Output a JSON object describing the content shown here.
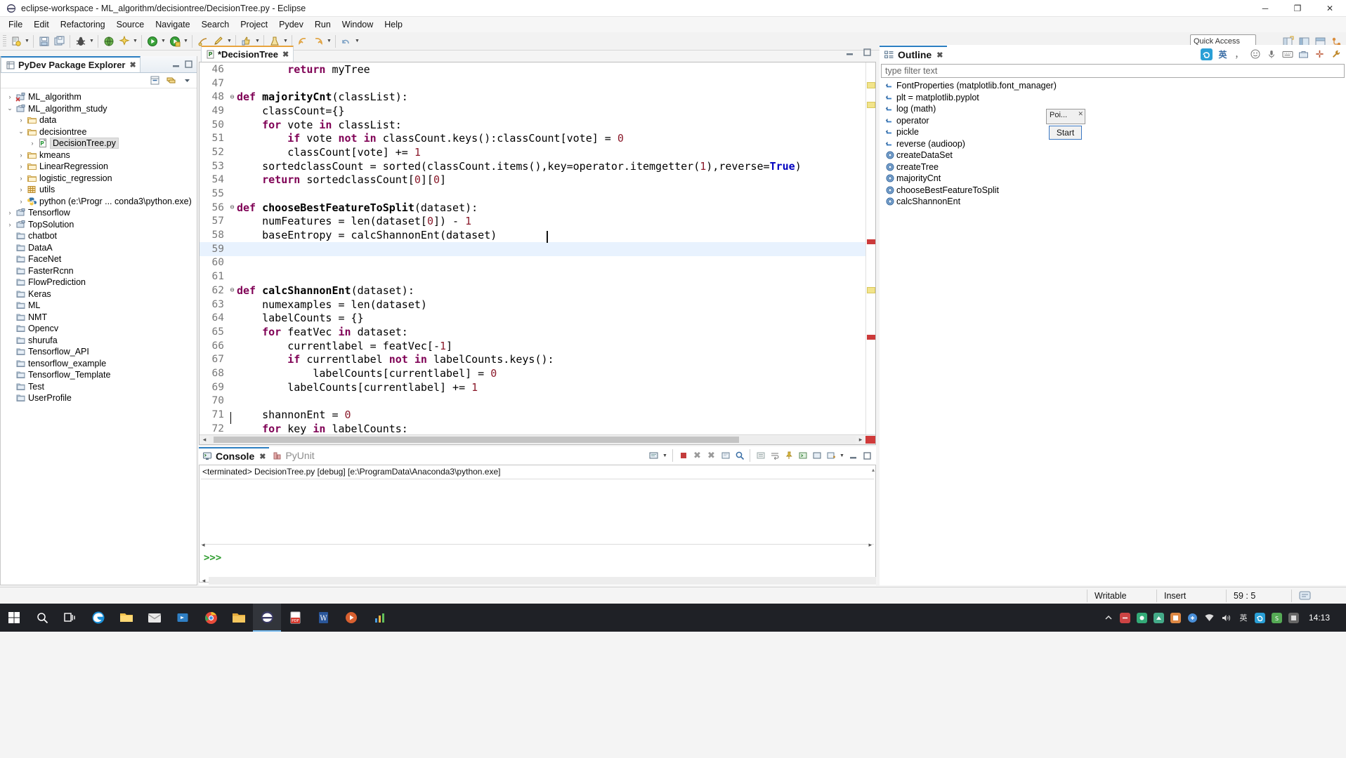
{
  "window": {
    "title": "eclipse-workspace - ML_algorithm/decisiontree/DecisionTree.py - Eclipse",
    "icon": "eclipse-icon",
    "minimize_label": "─",
    "maximize_label": "❐",
    "close_label": "✕"
  },
  "menubar": {
    "items": [
      {
        "label": "File"
      },
      {
        "label": "Edit"
      },
      {
        "label": "Refactoring"
      },
      {
        "label": "Source"
      },
      {
        "label": "Navigate"
      },
      {
        "label": "Search"
      },
      {
        "label": "Project"
      },
      {
        "label": "Pydev"
      },
      {
        "label": "Run"
      },
      {
        "label": "Window"
      },
      {
        "label": "Help"
      }
    ]
  },
  "toolbar": {
    "quick_access_placeholder": "Quick Access"
  },
  "explorer": {
    "title": "PyDev Package Explorer",
    "close_label": "✖",
    "tree": [
      {
        "label": "ML_algorithm",
        "depth": 0,
        "twist": "›",
        "icon": "project-error-icon"
      },
      {
        "label": "ML_algorithm_study",
        "depth": 0,
        "twist": "⌄",
        "icon": "project-icon"
      },
      {
        "label": "data",
        "depth": 1,
        "twist": "›",
        "icon": "folder-icon"
      },
      {
        "label": "decisiontree",
        "depth": 1,
        "twist": "⌄",
        "icon": "folder-icon"
      },
      {
        "label": "DecisionTree.py",
        "depth": 2,
        "twist": "›",
        "icon": "python-file-icon",
        "selected": true
      },
      {
        "label": "kmeans",
        "depth": 1,
        "twist": "›",
        "icon": "folder-icon"
      },
      {
        "label": "LinearRegression",
        "depth": 1,
        "twist": "›",
        "icon": "folder-icon"
      },
      {
        "label": "logistic_regression",
        "depth": 1,
        "twist": "›",
        "icon": "folder-icon"
      },
      {
        "label": "utils",
        "depth": 1,
        "twist": "›",
        "icon": "package-icon"
      },
      {
        "label": "python  (e:\\Progr ... conda3\\python.exe)",
        "depth": 1,
        "twist": "›",
        "icon": "python-interp-icon"
      },
      {
        "label": "Tensorflow",
        "depth": 0,
        "twist": "›",
        "icon": "project-icon"
      },
      {
        "label": "TopSolution",
        "depth": 0,
        "twist": "›",
        "icon": "project-icon"
      },
      {
        "label": "chatbot",
        "depth": 0,
        "twist": "",
        "icon": "closed-project-icon"
      },
      {
        "label": "DataA",
        "depth": 0,
        "twist": "",
        "icon": "closed-project-icon"
      },
      {
        "label": "FaceNet",
        "depth": 0,
        "twist": "",
        "icon": "closed-project-icon"
      },
      {
        "label": "FasterRcnn",
        "depth": 0,
        "twist": "",
        "icon": "closed-project-icon"
      },
      {
        "label": "FlowPrediction",
        "depth": 0,
        "twist": "",
        "icon": "closed-project-icon"
      },
      {
        "label": "Keras",
        "depth": 0,
        "twist": "",
        "icon": "closed-project-icon"
      },
      {
        "label": "ML",
        "depth": 0,
        "twist": "",
        "icon": "closed-project-icon"
      },
      {
        "label": "NMT",
        "depth": 0,
        "twist": "",
        "icon": "closed-project-icon"
      },
      {
        "label": "Opencv",
        "depth": 0,
        "twist": "",
        "icon": "closed-project-icon"
      },
      {
        "label": "shurufa",
        "depth": 0,
        "twist": "",
        "icon": "closed-project-icon"
      },
      {
        "label": "Tensorflow_API",
        "depth": 0,
        "twist": "",
        "icon": "closed-project-icon"
      },
      {
        "label": "tensorflow_example",
        "depth": 0,
        "twist": "",
        "icon": "closed-project-icon"
      },
      {
        "label": "Tensorflow_Template",
        "depth": 0,
        "twist": "",
        "icon": "closed-project-icon"
      },
      {
        "label": "Test",
        "depth": 0,
        "twist": "",
        "icon": "closed-project-icon"
      },
      {
        "label": "UserProfile",
        "depth": 0,
        "twist": "",
        "icon": "closed-project-icon"
      }
    ]
  },
  "editor": {
    "tab_label": "*DecisionTree",
    "tab_close": "✖",
    "first_line": 46,
    "cursor_line": 59,
    "lines": [
      {
        "n": 46,
        "indent": 2,
        "tokens": [
          {
            "t": "return",
            "c": "kw"
          },
          {
            "t": " myTree",
            "c": ""
          }
        ]
      },
      {
        "n": 47,
        "indent": 0,
        "tokens": []
      },
      {
        "n": 48,
        "indent": 0,
        "fold": "⊖",
        "tokens": [
          {
            "t": "def",
            "c": "kw"
          },
          {
            "t": " ",
            "c": ""
          },
          {
            "t": "majorityCnt",
            "c": "fn"
          },
          {
            "t": "(classList):",
            "c": ""
          }
        ]
      },
      {
        "n": 49,
        "indent": 1,
        "tokens": [
          {
            "t": "classCount={}",
            "c": ""
          }
        ]
      },
      {
        "n": 50,
        "indent": 1,
        "tokens": [
          {
            "t": "for",
            "c": "kw"
          },
          {
            "t": " vote ",
            "c": ""
          },
          {
            "t": "in",
            "c": "kw"
          },
          {
            "t": " classList:",
            "c": ""
          }
        ]
      },
      {
        "n": 51,
        "indent": 2,
        "tokens": [
          {
            "t": "if",
            "c": "kw"
          },
          {
            "t": " vote ",
            "c": ""
          },
          {
            "t": "not",
            "c": "kw"
          },
          {
            "t": " ",
            "c": ""
          },
          {
            "t": "in",
            "c": "kw"
          },
          {
            "t": " classCount.keys():classCount[vote] = ",
            "c": ""
          },
          {
            "t": "0",
            "c": "num"
          }
        ]
      },
      {
        "n": 52,
        "indent": 2,
        "tokens": [
          {
            "t": "classCount[vote] += ",
            "c": ""
          },
          {
            "t": "1",
            "c": "num"
          }
        ]
      },
      {
        "n": 53,
        "indent": 1,
        "tokens": [
          {
            "t": "sortedclassCount = sorted(classCount.items(),key=operator.itemgetter(",
            "c": ""
          },
          {
            "t": "1",
            "c": "num"
          },
          {
            "t": "),reverse=",
            "c": ""
          },
          {
            "t": "True",
            "c": "kw2"
          },
          {
            "t": ")",
            "c": ""
          }
        ]
      },
      {
        "n": 54,
        "indent": 1,
        "tokens": [
          {
            "t": "return",
            "c": "kw"
          },
          {
            "t": " sortedclassCount[",
            "c": ""
          },
          {
            "t": "0",
            "c": "num"
          },
          {
            "t": "][",
            "c": ""
          },
          {
            "t": "0",
            "c": "num"
          },
          {
            "t": "]",
            "c": ""
          }
        ]
      },
      {
        "n": 55,
        "indent": 0,
        "tokens": []
      },
      {
        "n": 56,
        "indent": 0,
        "fold": "⊖",
        "tokens": [
          {
            "t": "def",
            "c": "kw"
          },
          {
            "t": " ",
            "c": ""
          },
          {
            "t": "chooseBestFeatureToSplit",
            "c": "fn"
          },
          {
            "t": "(dataset):",
            "c": ""
          }
        ]
      },
      {
        "n": 57,
        "indent": 1,
        "marker": "error",
        "tokens": [
          {
            "t": "numFeatures = len(dataset[",
            "c": ""
          },
          {
            "t": "0",
            "c": "num"
          },
          {
            "t": "]) - ",
            "c": ""
          },
          {
            "t": "1",
            "c": "num"
          }
        ]
      },
      {
        "n": 58,
        "indent": 1,
        "marker": "error",
        "tokens": [
          {
            "t": "baseEntropy = calcShannonEnt(dataset)",
            "c": ""
          }
        ]
      },
      {
        "n": 59,
        "indent": 0,
        "current": true,
        "tokens": []
      },
      {
        "n": 60,
        "indent": 0,
        "tokens": []
      },
      {
        "n": 61,
        "indent": 0,
        "tokens": []
      },
      {
        "n": 62,
        "indent": 0,
        "fold": "⊖",
        "tokens": [
          {
            "t": "def",
            "c": "kw"
          },
          {
            "t": " ",
            "c": ""
          },
          {
            "t": "calcShannonEnt",
            "c": "fn"
          },
          {
            "t": "(dataset):",
            "c": ""
          }
        ]
      },
      {
        "n": 63,
        "indent": 1,
        "tokens": [
          {
            "t": "numexamples = len(dataset)",
            "c": ""
          }
        ]
      },
      {
        "n": 64,
        "indent": 1,
        "tokens": [
          {
            "t": "labelCounts = {}",
            "c": ""
          }
        ]
      },
      {
        "n": 65,
        "indent": 1,
        "tokens": [
          {
            "t": "for",
            "c": "kw"
          },
          {
            "t": " featVec ",
            "c": ""
          },
          {
            "t": "in",
            "c": "kw"
          },
          {
            "t": " dataset:",
            "c": ""
          }
        ]
      },
      {
        "n": 66,
        "indent": 2,
        "tokens": [
          {
            "t": "currentlabel = featVec[-",
            "c": ""
          },
          {
            "t": "1",
            "c": "num"
          },
          {
            "t": "]",
            "c": ""
          }
        ]
      },
      {
        "n": 67,
        "indent": 2,
        "tokens": [
          {
            "t": "if",
            "c": "kw"
          },
          {
            "t": " currentlabel ",
            "c": ""
          },
          {
            "t": "not",
            "c": "kw"
          },
          {
            "t": " ",
            "c": ""
          },
          {
            "t": "in",
            "c": "kw"
          },
          {
            "t": " labelCounts.keys():",
            "c": ""
          }
        ]
      },
      {
        "n": 68,
        "indent": 3,
        "tokens": [
          {
            "t": "labelCounts[currentlabel] = ",
            "c": ""
          },
          {
            "t": "0",
            "c": "num"
          }
        ]
      },
      {
        "n": 69,
        "indent": 2,
        "tokens": [
          {
            "t": "labelCounts[currentlabel] += ",
            "c": ""
          },
          {
            "t": "1",
            "c": "num"
          }
        ]
      },
      {
        "n": 70,
        "indent": 0,
        "tokens": []
      },
      {
        "n": 71,
        "indent": 1,
        "tokens": [
          {
            "t": "shannonEnt = ",
            "c": ""
          },
          {
            "t": "0",
            "c": "num"
          }
        ]
      },
      {
        "n": 72,
        "indent": 1,
        "tokens": [
          {
            "t": "for",
            "c": "kw"
          },
          {
            "t": " key ",
            "c": ""
          },
          {
            "t": "in",
            "c": "kw"
          },
          {
            "t": " labelCounts:",
            "c": ""
          }
        ]
      }
    ]
  },
  "outline": {
    "title": "Outline",
    "close_label": "✖",
    "filter_placeholder": "type filter text",
    "items": [
      {
        "label": "FontProperties (matplotlib.font_manager)",
        "icon": "import-icon"
      },
      {
        "label": "plt = matplotlib.pyplot",
        "icon": "import-icon"
      },
      {
        "label": "log (math)",
        "icon": "import-icon"
      },
      {
        "label": "operator",
        "icon": "import-icon"
      },
      {
        "label": "pickle",
        "icon": "import-icon"
      },
      {
        "label": "reverse (audioop)",
        "icon": "import-icon"
      },
      {
        "label": "createDataSet",
        "icon": "method-icon"
      },
      {
        "label": "createTree",
        "icon": "method-icon"
      },
      {
        "label": "majorityCnt",
        "icon": "method-icon"
      },
      {
        "label": "chooseBestFeatureToSplit",
        "icon": "method-icon"
      },
      {
        "label": "calcShannonEnt",
        "icon": "method-icon"
      }
    ]
  },
  "popup": {
    "title": "Poi...",
    "close_label": "✕",
    "start_label": "Start"
  },
  "console": {
    "tab_label": "Console",
    "tab_close": "✖",
    "tab2_label": "PyUnit",
    "terminated_text": "<terminated> DecisionTree.py [debug] [e:\\ProgramData\\Anaconda3\\python.exe]",
    "prompt": ">>>"
  },
  "statusbar": {
    "writable": "Writable",
    "insert": "Insert",
    "position": "59 : 5"
  },
  "taskbar": {
    "clock_time": "14:13",
    "items": [
      {
        "icon": "windows-start-icon"
      },
      {
        "icon": "search-icon"
      },
      {
        "icon": "task-view-icon"
      },
      {
        "icon": "edge-icon"
      },
      {
        "icon": "explorer-icon"
      },
      {
        "icon": "mail-icon"
      },
      {
        "icon": "store-icon"
      },
      {
        "icon": "chrome-icon"
      },
      {
        "icon": "folder-icon"
      },
      {
        "icon": "eclipse-icon"
      },
      {
        "icon": "pdf-icon"
      },
      {
        "icon": "word-icon"
      },
      {
        "icon": "media-icon"
      },
      {
        "icon": "chart-icon"
      }
    ]
  },
  "colors": {
    "accent": "#2b7ec1",
    "editor_tab_accent": "#e8a33d",
    "keyword": "#7f0055",
    "builtin": "#0000c0",
    "number": "#8b1a2b",
    "selection": "#e8f2fe"
  }
}
